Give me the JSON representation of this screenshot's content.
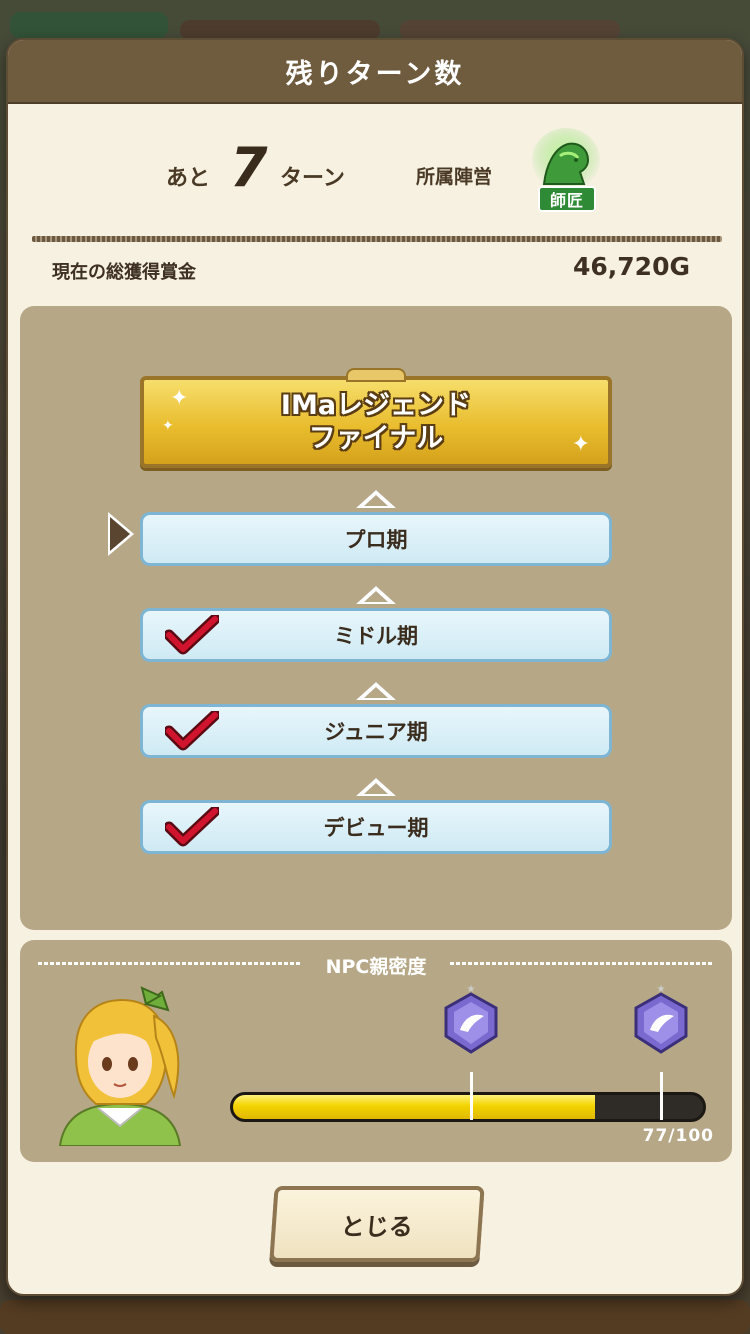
{
  "header": {
    "title": "残りターン数"
  },
  "turns": {
    "prefix": "あと",
    "number": "7",
    "suffix": "ターン"
  },
  "faction": {
    "label": "所属陣営",
    "badge_text": "師匠",
    "icon": "bust-statue-icon"
  },
  "prize": {
    "label": "現在の総獲得賞金",
    "value": "46,720G"
  },
  "stages": {
    "final": {
      "line1": "IMaレジェンド",
      "line2": "ファイナル"
    },
    "items": [
      {
        "label": "プロ期",
        "current": true,
        "completed": false
      },
      {
        "label": "ミドル期",
        "current": false,
        "completed": true
      },
      {
        "label": "ジュニア期",
        "current": false,
        "completed": true
      },
      {
        "label": "デビュー期",
        "current": false,
        "completed": true
      }
    ]
  },
  "npc": {
    "title": "NPC親密度",
    "progress": 77,
    "max": 100,
    "count_text": "77/100",
    "milestones": [
      50,
      90
    ]
  },
  "buttons": {
    "close": "とじる"
  },
  "colors": {
    "header": "#6f5b3e",
    "panel": "#b6a887",
    "stage_fill": "#cfeaf4",
    "bar_fill": "#f2d400",
    "check": "#c8102e"
  }
}
